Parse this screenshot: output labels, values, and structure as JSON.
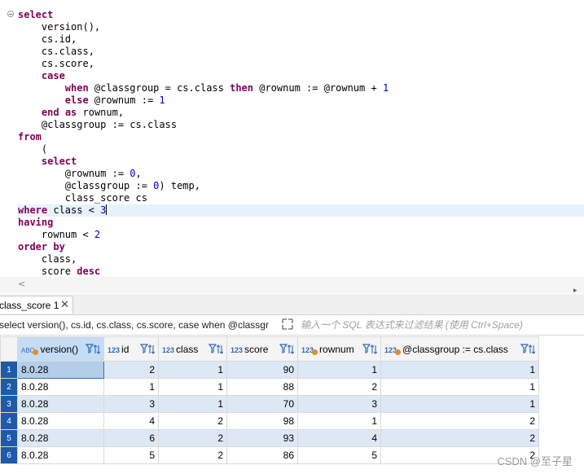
{
  "editor": {
    "lines": [
      [
        {
          "t": "select",
          "c": "kw"
        }
      ],
      [
        {
          "t": "    version(),"
        }
      ],
      [
        {
          "t": "    cs.id,"
        }
      ],
      [
        {
          "t": "    cs.class,"
        }
      ],
      [
        {
          "t": "    cs.score,"
        }
      ],
      [
        {
          "t": "    "
        },
        {
          "t": "case",
          "c": "kw"
        }
      ],
      [
        {
          "t": "        "
        },
        {
          "t": "when",
          "c": "kw"
        },
        {
          "t": " @classgroup = cs.class "
        },
        {
          "t": "then",
          "c": "kw"
        },
        {
          "t": " @rownum := @rownum + "
        },
        {
          "t": "1",
          "c": "num"
        }
      ],
      [
        {
          "t": "        "
        },
        {
          "t": "else",
          "c": "kw"
        },
        {
          "t": " @rownum := "
        },
        {
          "t": "1",
          "c": "num"
        }
      ],
      [
        {
          "t": "    "
        },
        {
          "t": "end",
          "c": "kw"
        },
        {
          "t": " "
        },
        {
          "t": "as",
          "c": "kw"
        },
        {
          "t": " rownum,"
        }
      ],
      [
        {
          "t": "    @classgroup := cs.class"
        }
      ],
      [
        {
          "t": "from",
          "c": "kw"
        }
      ],
      [
        {
          "t": "    ("
        }
      ],
      [
        {
          "t": "    "
        },
        {
          "t": "select",
          "c": "kw"
        }
      ],
      [
        {
          "t": "        @rownum := "
        },
        {
          "t": "0",
          "c": "num"
        },
        {
          "t": ","
        }
      ],
      [
        {
          "t": "        @classgroup := "
        },
        {
          "t": "0",
          "c": "num"
        },
        {
          "t": ") temp,"
        }
      ],
      [
        {
          "t": "        class_score cs"
        }
      ],
      [
        {
          "t": "where",
          "c": "kw"
        },
        {
          "t": " class < "
        },
        {
          "t": "3",
          "c": "num"
        },
        {
          "caret": true
        }
      ],
      [
        {
          "t": "having",
          "c": "kw"
        }
      ],
      [
        {
          "t": "    rownum < "
        },
        {
          "t": "2",
          "c": "num"
        }
      ],
      [
        {
          "t": "order",
          "c": "kw"
        },
        {
          "t": " "
        },
        {
          "t": "by",
          "c": "kw"
        }
      ],
      [
        {
          "t": "    class,"
        }
      ],
      [
        {
          "t": "    score "
        },
        {
          "t": "desc",
          "c": "kw"
        }
      ]
    ],
    "current_line": 16
  },
  "results": {
    "tab_label": "class_score 1",
    "query_text": "select version(), cs.id, cs.class, cs.score, case when @classgr",
    "filter_placeholder": "输入一个 SQL 表达式来过滤结果 (使用 Ctrl+Space)",
    "columns": [
      {
        "label": "version()",
        "type": "ABC"
      },
      {
        "label": "id",
        "type": "123"
      },
      {
        "label": "class",
        "type": "123"
      },
      {
        "label": "score",
        "type": "123"
      },
      {
        "label": "rownum",
        "type": "123"
      },
      {
        "label": "@classgroup := cs.class",
        "type": "123"
      }
    ],
    "rows": [
      {
        "num": "1",
        "cells": [
          "8.0.28",
          "2",
          "1",
          "90",
          "1",
          "1"
        ]
      },
      {
        "num": "2",
        "cells": [
          "8.0.28",
          "1",
          "1",
          "88",
          "2",
          "1"
        ]
      },
      {
        "num": "3",
        "cells": [
          "8.0.28",
          "3",
          "1",
          "70",
          "3",
          "1"
        ]
      },
      {
        "num": "4",
        "cells": [
          "8.0.28",
          "4",
          "2",
          "98",
          "1",
          "2"
        ]
      },
      {
        "num": "5",
        "cells": [
          "8.0.28",
          "6",
          "2",
          "93",
          "4",
          "2"
        ]
      },
      {
        "num": "6",
        "cells": [
          "8.0.28",
          "5",
          "2",
          "86",
          "5",
          "2"
        ]
      }
    ]
  },
  "watermark": "CSDN @至子星",
  "colors": {
    "keyword": "#7f0055",
    "number": "#0000c0",
    "selection": "#1e5aa8",
    "alt_row": "#dde8f6"
  }
}
